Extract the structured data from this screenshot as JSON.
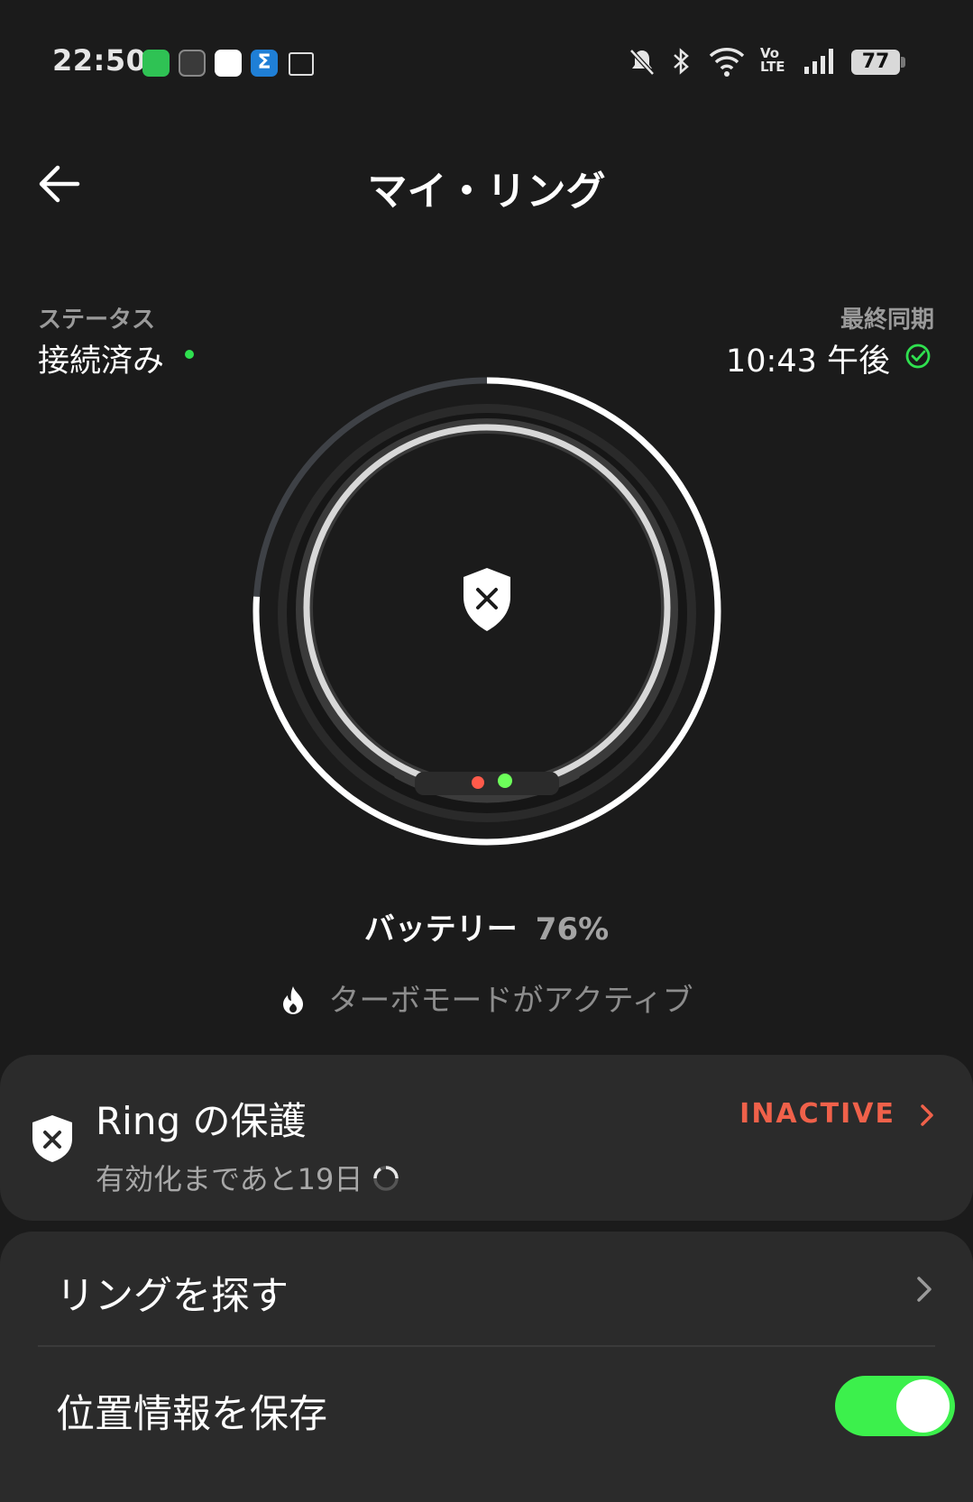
{
  "status_bar": {
    "time": "22:50",
    "battery": "77",
    "left_icons": [
      "line-app-icon",
      "battery-app-icon",
      "photos-app-icon",
      "sigma-app-icon",
      "calendar-icon"
    ],
    "right_icons": [
      "mute-icon",
      "bluetooth-icon",
      "wifi-icon",
      "volte-icon",
      "signal-icon"
    ]
  },
  "header": {
    "title": "マイ・リング"
  },
  "status": {
    "label": "ステータス",
    "value": "接続済み",
    "sync_label": "最終同期",
    "sync_value": "10:43 午後"
  },
  "battery": {
    "label": "バッテリー",
    "value": "76%",
    "level": 0.76
  },
  "turbo": {
    "text": "ターボモードがアクティブ"
  },
  "protection": {
    "title": "Ring の保護",
    "subtitle": "有効化まであと19日",
    "status": "INACTIVE"
  },
  "list": {
    "find_ring": "リングを探す",
    "save_location": "位置情報を保存",
    "save_location_enabled": true
  },
  "colors": {
    "background": "#1b1b1b",
    "card": "#2b2b2b",
    "accent_green": "#3cf04c",
    "inactive_red": "#f0614a"
  }
}
